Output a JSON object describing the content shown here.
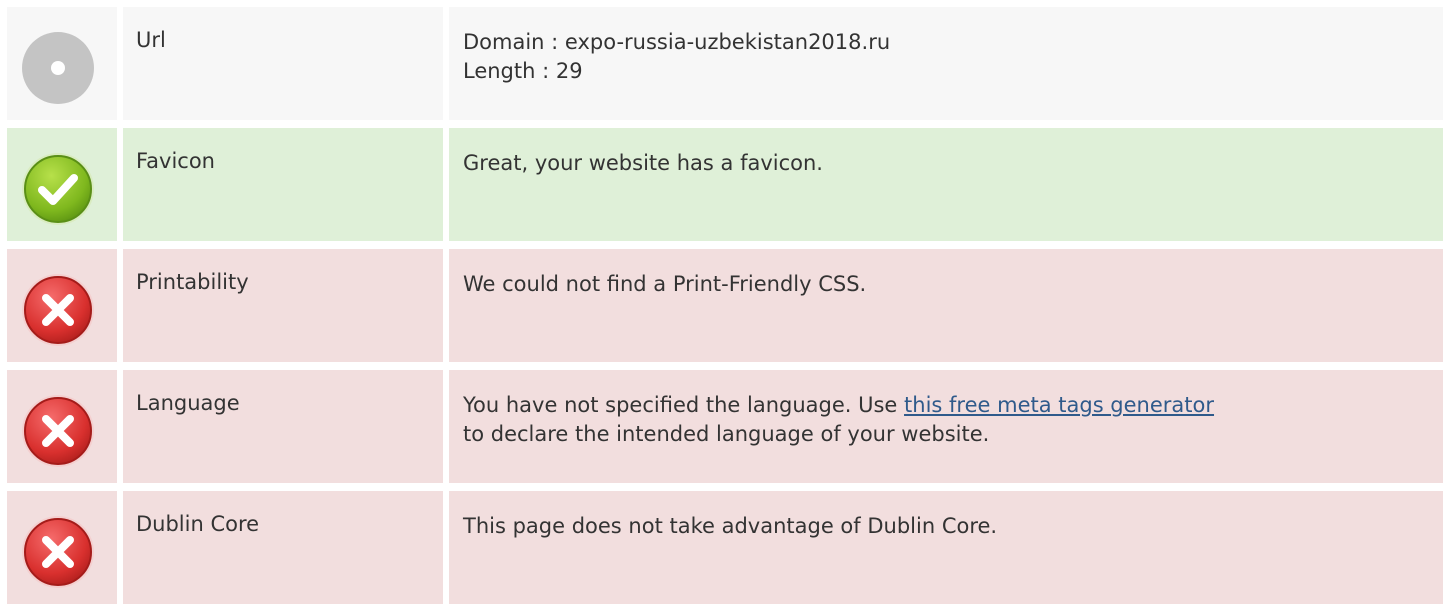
{
  "rows": [
    {
      "status": "neutral",
      "icon": "neutral-circle-icon",
      "label": "Url",
      "lines": [
        "Domain : expo-russia-uzbekistan2018.ru",
        "Length : 29"
      ]
    },
    {
      "status": "good",
      "icon": "check-circle-icon",
      "label": "Favicon",
      "text": "Great, your website has a favicon."
    },
    {
      "status": "bad",
      "icon": "error-x-icon",
      "label": "Printability",
      "text": "We could not find a Print-Friendly CSS."
    },
    {
      "status": "bad",
      "icon": "error-x-icon",
      "label": "Language",
      "text_before": "You have not specified the language. Use ",
      "link_text": "this free meta tags generator",
      "text_after": "to declare the intended language of your website."
    },
    {
      "status": "bad",
      "icon": "error-x-icon",
      "label": "Dublin Core",
      "text": "This page does not take advantage of Dublin Core."
    }
  ],
  "colors": {
    "neutral_bg": "#f7f7f7",
    "good_bg": "#dff0d8",
    "bad_bg": "#f2dede",
    "link": "#2f5a8b"
  }
}
